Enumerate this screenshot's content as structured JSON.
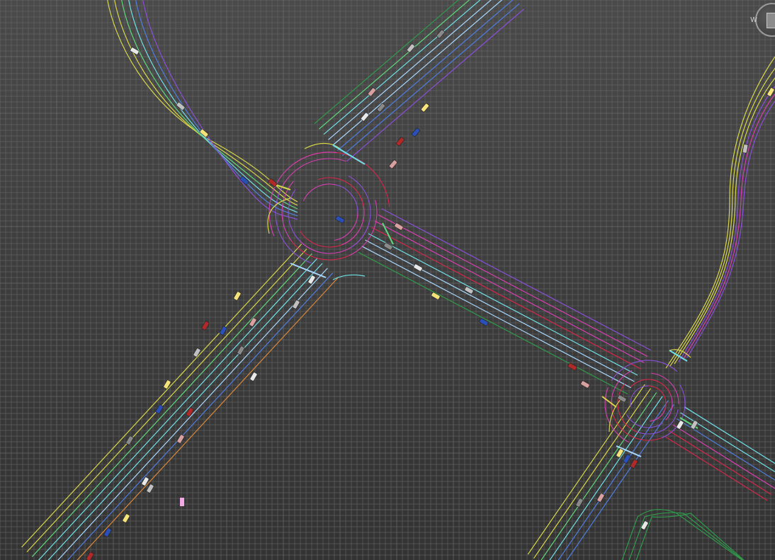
{
  "viewport": {
    "background_top": "#4a4a4a",
    "background_bottom": "#333333",
    "grid_color": "#6a6a6a",
    "grid_major_color": "#7a7a7a"
  },
  "viewcube": {
    "compass_letter": "W",
    "icon": "viewcube-icon"
  },
  "palette": {
    "yellow": "#d8d64a",
    "green": "#5fd67a",
    "cyan": "#6fe0e8",
    "blue": "#4f7de0",
    "purple": "#8a4fd8",
    "magenta": "#d63fb0",
    "red": "#d6264a",
    "orange": "#d8883a",
    "white": "#e8e8e8",
    "lightblue": "#a8d8ff",
    "darkgreen": "#2f9a4a"
  },
  "vehicle_colors": [
    "#e8e8e8",
    "#c0c0c0",
    "#f4e27a",
    "#2a4fb8",
    "#b02a2a",
    "#d8a0a0",
    "#8a8a8a"
  ],
  "selection_marker": {
    "color": "#f2a8e4"
  }
}
